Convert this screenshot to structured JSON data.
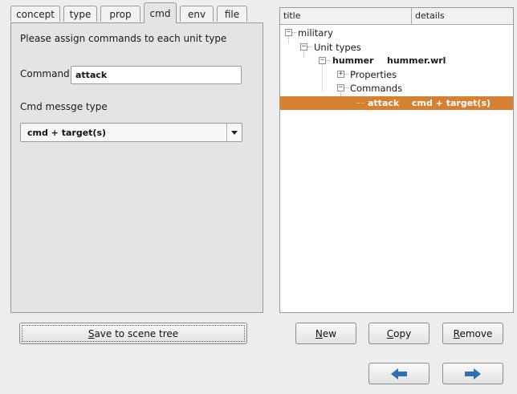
{
  "tabs": [
    {
      "label": "concept",
      "active": false
    },
    {
      "label": "type",
      "active": false
    },
    {
      "label": "prop",
      "active": false
    },
    {
      "label": "cmd",
      "active": true
    },
    {
      "label": "env",
      "active": false
    },
    {
      "label": "file",
      "active": false
    }
  ],
  "cmd_panel": {
    "instruction": "Please assign commands to each unit type",
    "command_label": "Command",
    "command_value": "attack",
    "msg_type_label": "Cmd messge type",
    "msg_type_value": "cmd + target(s)"
  },
  "save_button": {
    "label": "Save to scene tree",
    "mnemonic": "S",
    "rest": "ave to scene tree"
  },
  "tree": {
    "columns": [
      "title",
      "details"
    ],
    "nodes": {
      "military": {
        "title": "military",
        "toggle": "−"
      },
      "unit_types": {
        "title": "Unit types",
        "toggle": "−"
      },
      "hummer": {
        "title": "hummer",
        "detail": "hummer.wrl",
        "toggle": "−"
      },
      "properties": {
        "title": "Properties",
        "toggle": "+"
      },
      "commands": {
        "title": "Commands",
        "toggle": "−"
      },
      "attack": {
        "title": "attack",
        "detail": "cmd + target(s)",
        "selected": true
      }
    }
  },
  "buttons": {
    "new": {
      "mnemonic": "N",
      "rest": "ew"
    },
    "copy": {
      "mnemonic": "C",
      "rest": "opy"
    },
    "remove": {
      "mnemonic": "R",
      "rest": "emove"
    }
  },
  "nav": {
    "back_icon": "arrow-left-icon",
    "forward_icon": "arrow-right-icon",
    "arrow_color": "#2f6fb3"
  },
  "colors": {
    "selection": "#d58131"
  }
}
